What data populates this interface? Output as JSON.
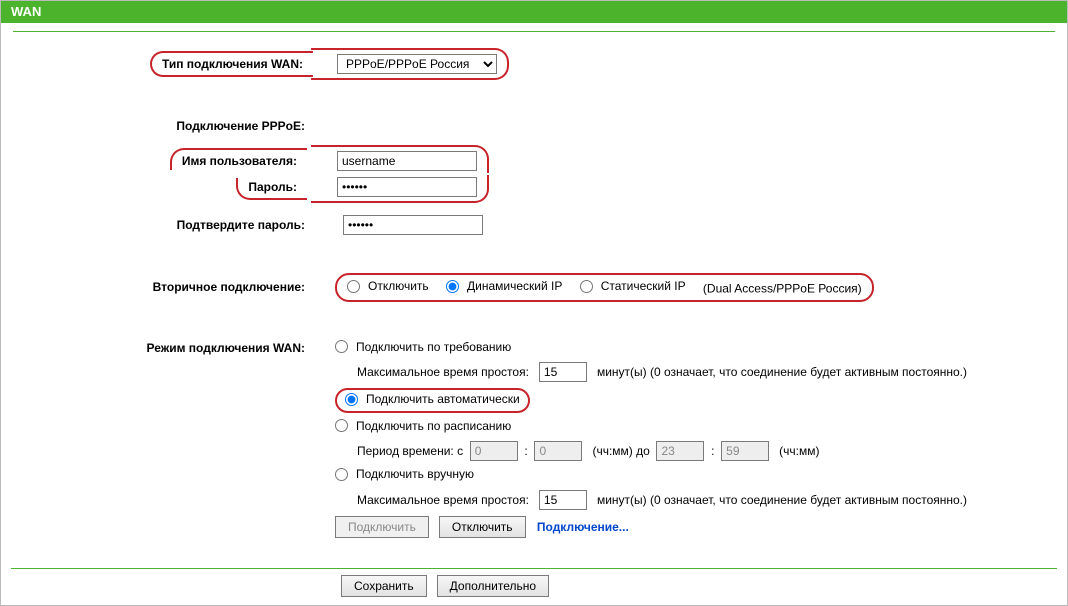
{
  "header": {
    "title": "WAN"
  },
  "labels": {
    "wan_type": "Тип подключения WAN:",
    "pppoe_section": "Подключение PPPoE:",
    "username": "Имя пользователя:",
    "password": "Пароль:",
    "password_confirm": "Подтвердите пароль:",
    "secondary": "Вторичное подключение:",
    "conn_mode": "Режим подключения WAN:"
  },
  "wan_type_select": {
    "value": "PPPoE/PPPoE Россия"
  },
  "cred": {
    "username": "username",
    "password": "••••••",
    "password_confirm": "••••••"
  },
  "secondary": {
    "options": {
      "off": "Отключить",
      "dyn": "Динамический IP",
      "stat": "Статический IP"
    },
    "suffix": "(Dual Access/PPPoE Россия)",
    "selected": "dyn"
  },
  "conn_mode": {
    "on_demand": {
      "label": "Подключить по требованию",
      "idle_label": "Максимальное время простоя:",
      "idle_value": "15",
      "idle_suffix": "минут(ы) (0 означает, что соединение будет активным постоянно.)"
    },
    "auto": {
      "label": "Подключить автоматически"
    },
    "schedule": {
      "label": "Подключить по расписанию",
      "period_label": "Период времени:  с",
      "from_h": "0",
      "from_m": "0",
      "to_label": "(чч:мм) до",
      "to_h": "23",
      "to_m": "59",
      "to_suffix": "(чч:мм)"
    },
    "manual": {
      "label": "Подключить вручную",
      "idle_label": "Максимальное время простоя:",
      "idle_value": "15",
      "idle_suffix": "минут(ы) (0 означает, что соединение будет активным постоянно.)"
    },
    "selected": "auto"
  },
  "buttons": {
    "connect": "Подключить",
    "disconnect": "Отключить",
    "save": "Сохранить",
    "advanced": "Дополнительно"
  },
  "status": {
    "text": "Подключение..."
  }
}
